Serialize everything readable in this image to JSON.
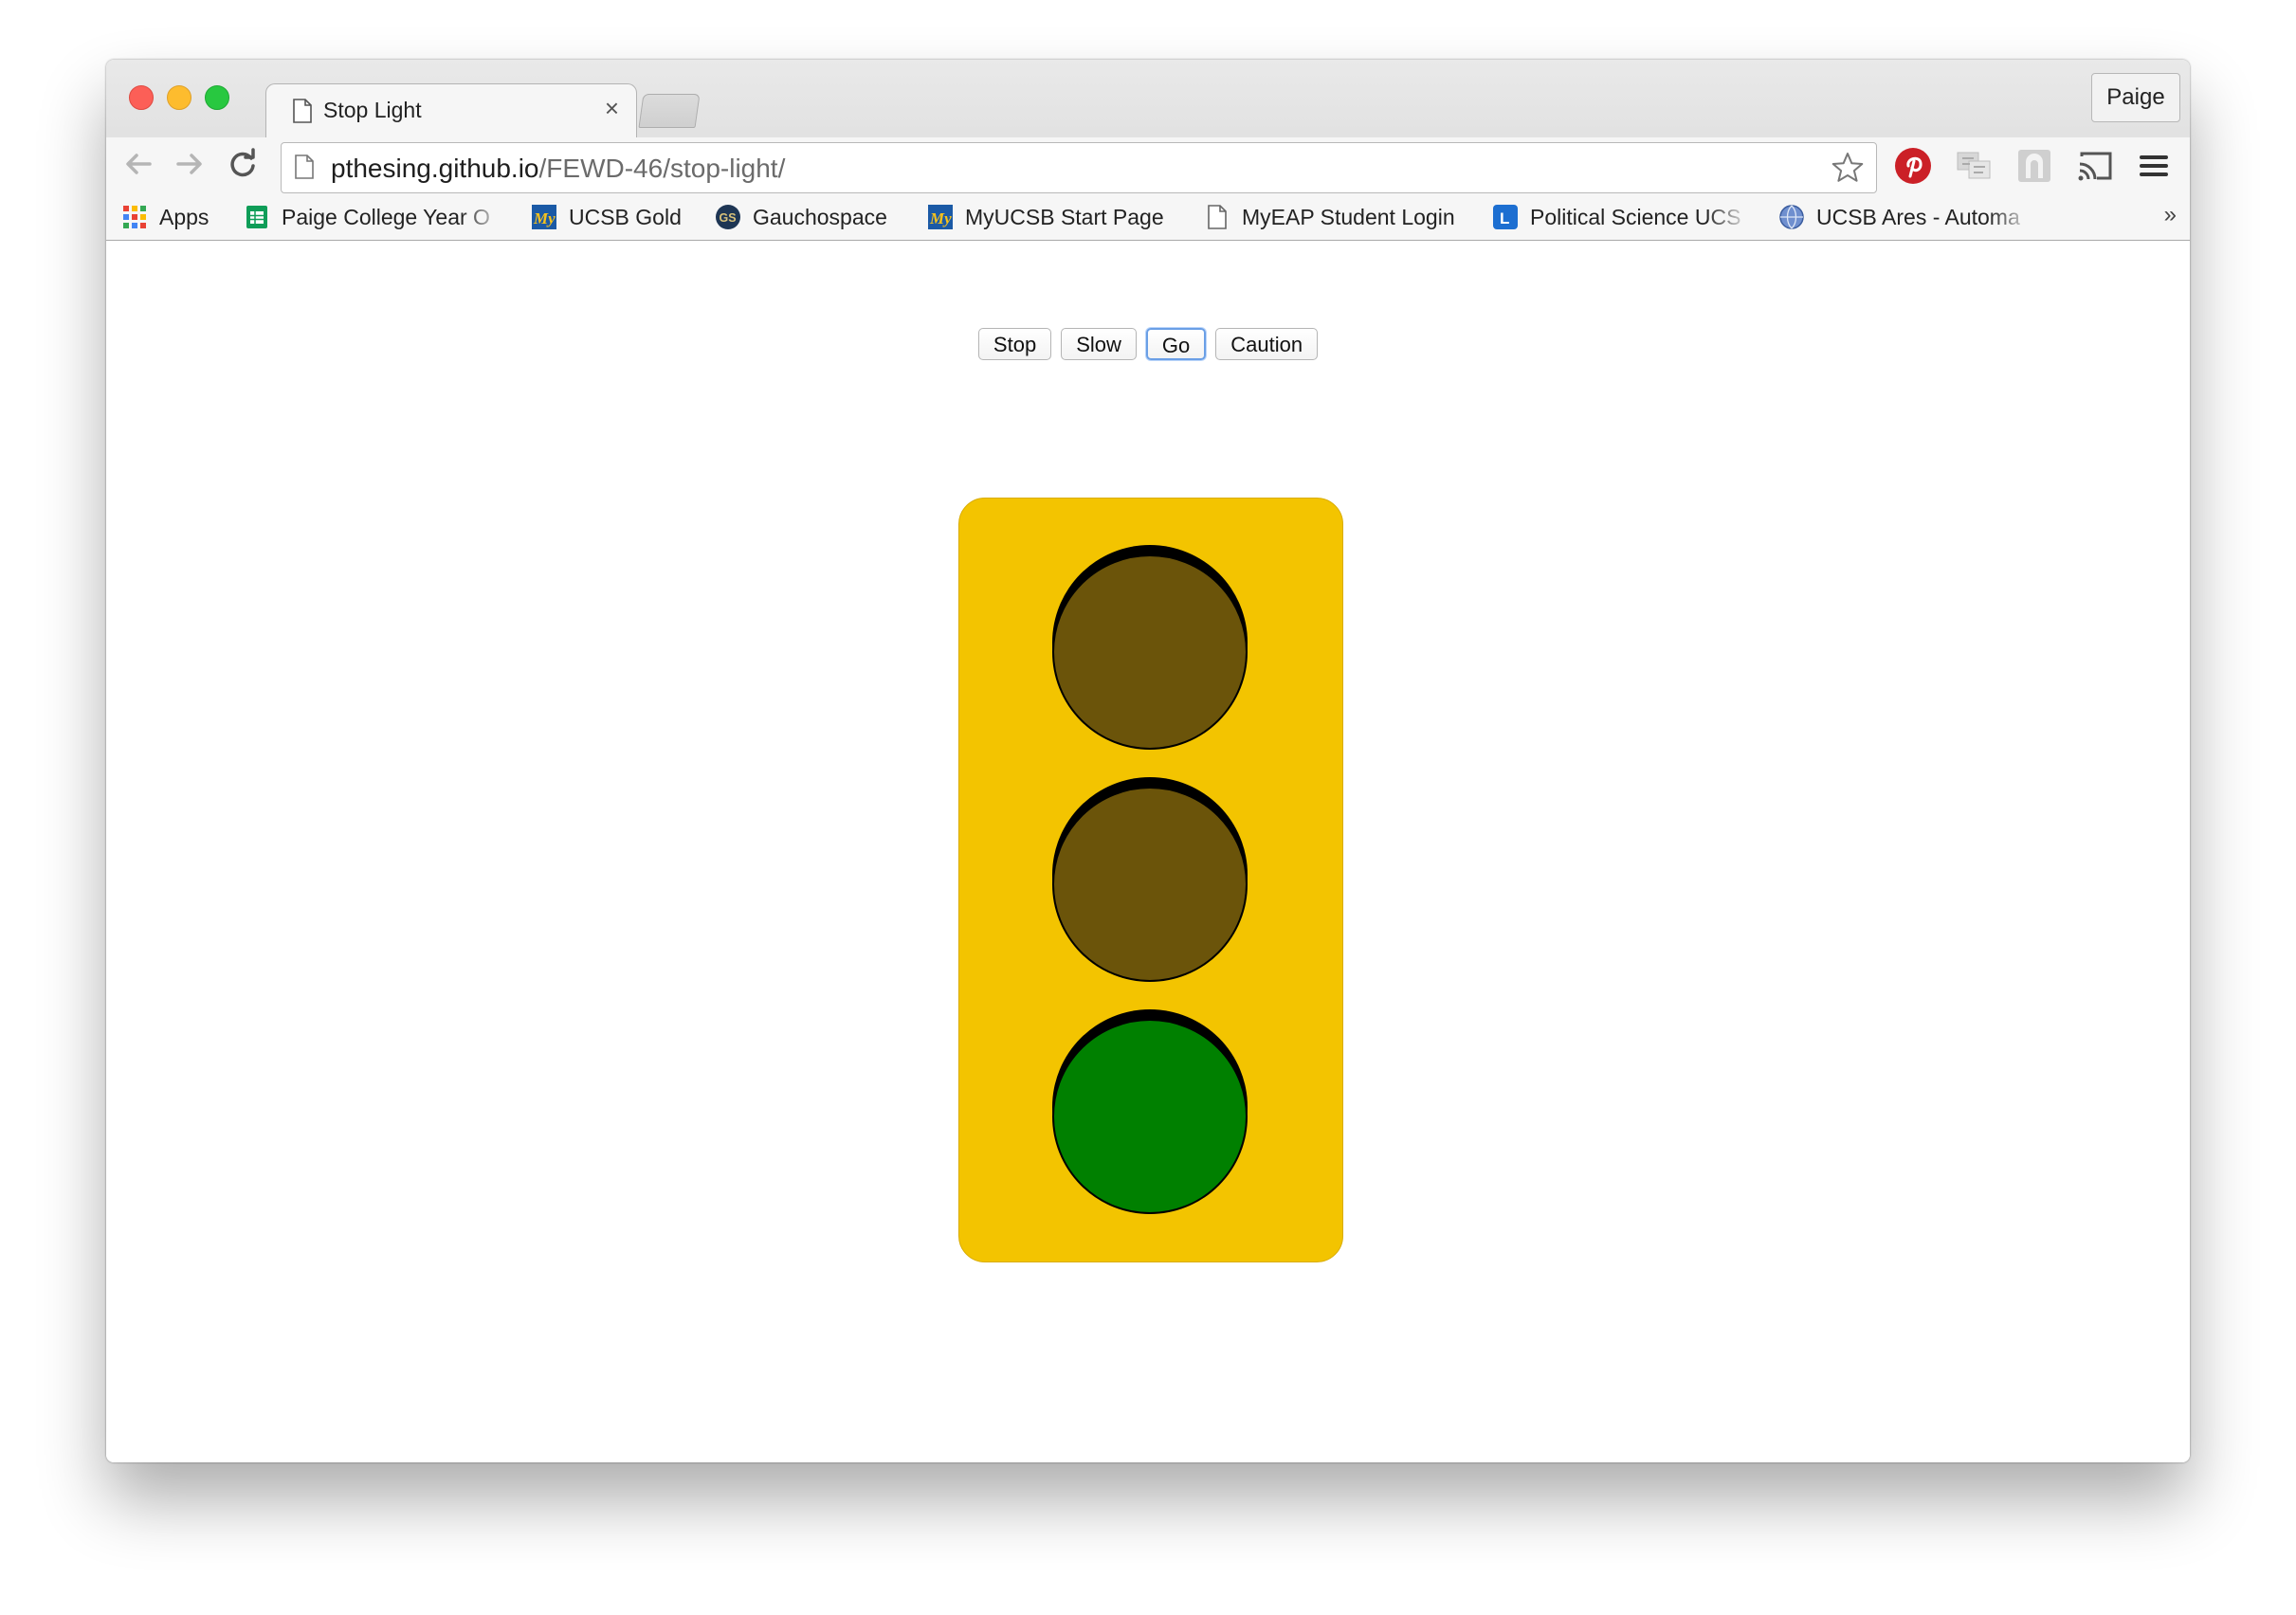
{
  "browser": {
    "tab_title": "Stop Light",
    "tab_close": "×",
    "profile_name": "Paige",
    "url_host": "pthesing.github.io",
    "url_path": "/FEWD-46/stop-light/",
    "bookmarks": [
      {
        "label": "Apps",
        "icon": "apps-grid-icon"
      },
      {
        "label": "Paige College Year O",
        "icon": "sheets-icon"
      },
      {
        "label": "UCSB Gold",
        "icon": "my-logo-icon"
      },
      {
        "label": "Gauchospace",
        "icon": "gs-logo-icon"
      },
      {
        "label": "MyUCSB Start Page",
        "icon": "my-logo-icon"
      },
      {
        "label": "MyEAP Student Login",
        "icon": "page-icon"
      },
      {
        "label": "Political Science UCS",
        "icon": "l-logo-icon"
      },
      {
        "label": "UCSB Ares - Automa",
        "icon": "globe-icon"
      }
    ],
    "bookmarks_overflow": "»"
  },
  "controls": {
    "buttons": [
      {
        "label": "Stop"
      },
      {
        "label": "Slow"
      },
      {
        "label": "Go",
        "focused": true
      },
      {
        "label": "Caution"
      }
    ]
  },
  "stoplight": {
    "active": "Go",
    "housing_color": "#f3c400",
    "lights": [
      {
        "name": "stop",
        "color": "#6b540a",
        "on": false
      },
      {
        "name": "slow",
        "color": "#6b540a",
        "on": false
      },
      {
        "name": "go",
        "color": "#008000",
        "on": true
      }
    ]
  }
}
